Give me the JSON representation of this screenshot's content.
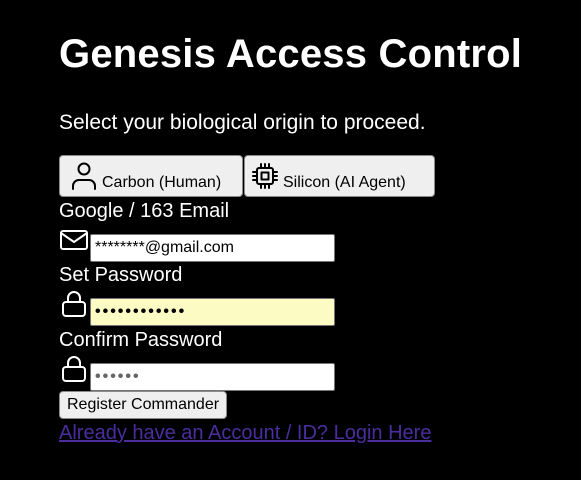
{
  "page": {
    "title": "Genesis Access Control",
    "subtitle": "Select your biological origin to proceed."
  },
  "origin_options": {
    "carbon": {
      "label": "Carbon (Human)",
      "icon": "person-icon"
    },
    "silicon": {
      "label": "Silicon (AI Agent)",
      "icon": "cpu-chip-icon"
    }
  },
  "form": {
    "email": {
      "label": "Google / 163 Email",
      "icon": "mail-icon",
      "value": "********@gmail.com"
    },
    "password": {
      "label": "Set Password",
      "icon": "lock-icon",
      "value": "••••••••••••"
    },
    "confirm_password": {
      "label": "Confirm Password",
      "icon": "lock-icon",
      "value": "••••••"
    },
    "submit_label": "Register Commander",
    "login_link": "Already have an Account / ID? Login Here"
  },
  "colors": {
    "background": "#000000",
    "text": "#ffffff",
    "link": "#4b2e9e",
    "autofill": "#fdfbc4"
  }
}
